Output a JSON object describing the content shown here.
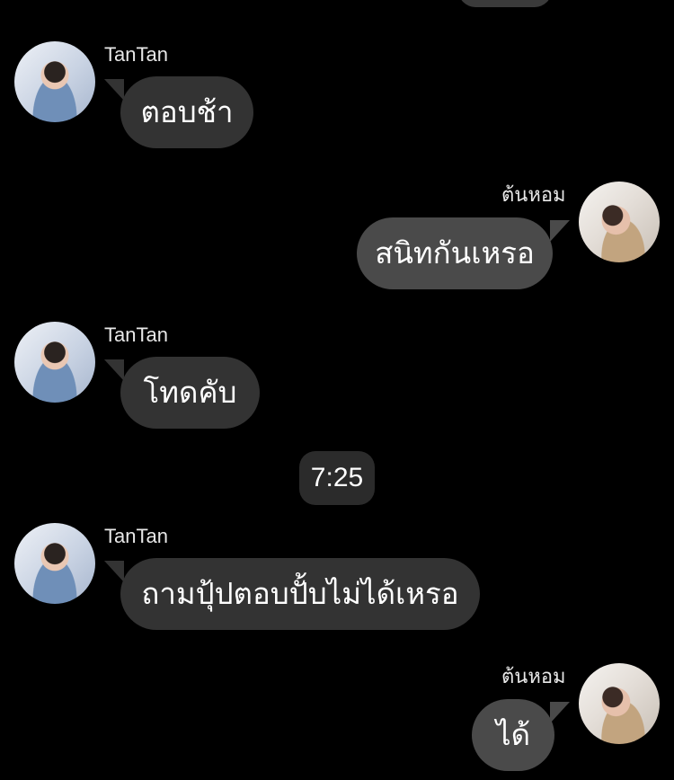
{
  "messages": [
    {
      "sender": "TanTan",
      "text": "ตอบช้า",
      "direction": "incoming",
      "avatar": "tantan-avatar"
    },
    {
      "sender": "ต้นหอม",
      "text": "สนิทกันเหรอ",
      "direction": "outgoing",
      "avatar": "tonhom-avatar"
    },
    {
      "sender": "TanTan",
      "text": "โทดคับ",
      "direction": "incoming",
      "avatar": "tantan-avatar"
    },
    {
      "sender": "TanTan",
      "text": "ถามปุ้ปตอบปั้บไม่ได้เหรอ",
      "direction": "incoming",
      "avatar": "tantan-avatar"
    },
    {
      "sender": "ต้นหอม",
      "text": "ได้",
      "direction": "outgoing",
      "avatar": "tonhom-avatar"
    }
  ],
  "timestamp": "7:25",
  "colors": {
    "background": "#000000",
    "incoming_bubble": "#333333",
    "outgoing_bubble": "#4a4a4a",
    "timestamp_pill": "#2b2b2b",
    "text": "#ffffff"
  }
}
